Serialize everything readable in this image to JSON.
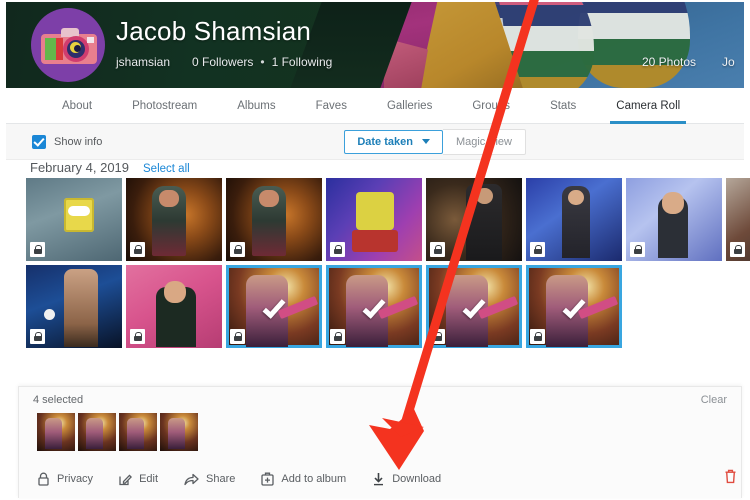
{
  "profile": {
    "name": "Jacob Shamsian",
    "username": "jshamsian",
    "followers": "0 Followers",
    "separator": "•",
    "following": "1 Following",
    "photo_count": "20 Photos",
    "right_cut_label": "Jo",
    "avatar_icon": "camera-icon"
  },
  "nav": {
    "tabs": [
      {
        "label": "About",
        "active": false
      },
      {
        "label": "Photostream",
        "active": false
      },
      {
        "label": "Albums",
        "active": false
      },
      {
        "label": "Faves",
        "active": false
      },
      {
        "label": "Galleries",
        "active": false
      },
      {
        "label": "Groups",
        "active": false
      },
      {
        "label": "Stats",
        "active": false
      },
      {
        "label": "Camera Roll",
        "active": true
      }
    ],
    "active_underline_color": "#2b8fc7"
  },
  "toolbar": {
    "show_info_label": "Show info",
    "show_info_checked": true,
    "checkbox_color": "#1b87d6",
    "date_taken_label": "Date taken",
    "date_taken_selected": true,
    "date_taken_color": "#1d7fb8",
    "magic_view_label": "Magic View"
  },
  "date_section": {
    "date_label": "February 4, 2019",
    "select_all_label": "Select all",
    "link_color": "#1b87d6"
  },
  "grid": {
    "selection_border_color": "#39a6e0",
    "lock_icon": "lock-icon",
    "check_icon": "check-icon",
    "rows": [
      {
        "cells": [
          {
            "art": "ph-sponge1",
            "selected": false,
            "locked": true
          },
          {
            "art": "ph-concert",
            "selected": false,
            "locked": true
          },
          {
            "art": "ph-concert",
            "selected": false,
            "locked": true
          },
          {
            "art": "ph-sponge2",
            "selected": false,
            "locked": true
          },
          {
            "art": "ph-dark",
            "selected": false,
            "locked": true
          },
          {
            "art": "ph-blue",
            "selected": false,
            "locked": true
          },
          {
            "art": "ph-lavender",
            "selected": false,
            "locked": true
          },
          {
            "art": "ph-couch",
            "selected": false,
            "locked": true
          }
        ]
      },
      {
        "cells": [
          {
            "art": "ph-stage",
            "selected": false,
            "locked": true
          },
          {
            "art": "ph-pink",
            "selected": false,
            "locked": true
          },
          {
            "art": "ph-guitar",
            "selected": true,
            "locked": true
          },
          {
            "art": "ph-guitar",
            "selected": true,
            "locked": true
          },
          {
            "art": "ph-guitar",
            "selected": true,
            "locked": true
          },
          {
            "art": "ph-guitar",
            "selected": true,
            "locked": true
          }
        ]
      }
    ]
  },
  "selection_bar": {
    "count_label": "4 selected",
    "clear_label": "Clear",
    "thumbnail_count": 4,
    "actions": [
      {
        "label": "Privacy",
        "icon": "lock-icon"
      },
      {
        "label": "Edit",
        "icon": "pencil-square-icon"
      },
      {
        "label": "Share",
        "icon": "share-arrow-icon"
      },
      {
        "label": "Add to album",
        "icon": "add-to-album-icon"
      },
      {
        "label": "Download",
        "icon": "download-icon"
      }
    ],
    "delete_icon": "trash-icon",
    "delete_icon_color": "#e04b3f"
  },
  "annotation": {
    "arrow_color": "#f4331f",
    "points_to": "Download"
  }
}
